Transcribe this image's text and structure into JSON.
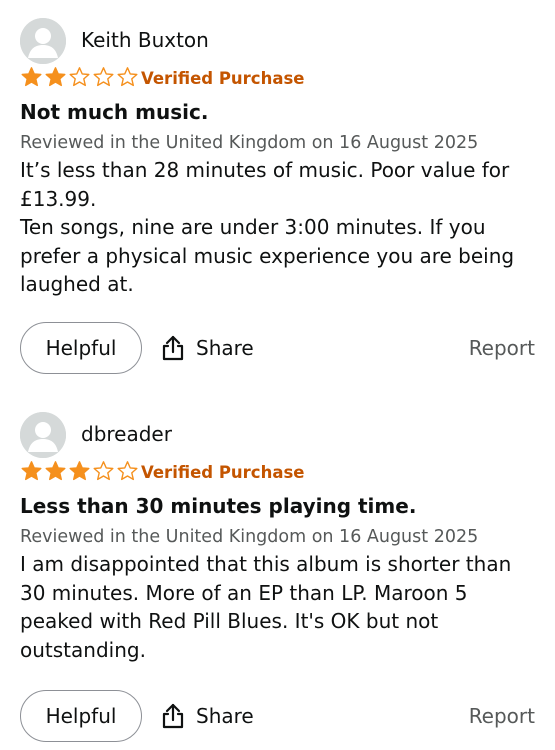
{
  "colors": {
    "star": "#f5901d",
    "verified": "#c45500",
    "meta": "#565959",
    "avatar_bg": "#d5d9d9"
  },
  "reviews": [
    {
      "author": "Keith Buxton",
      "rating": 2,
      "max_rating": 5,
      "badge": "Verified Purchase",
      "title": "Not much music.",
      "meta": "Reviewed in the United Kingdom on 16 August 2025",
      "body_lines": [
        "It’s less than 28 minutes of music. Poor value for",
        "£13.99.",
        "Ten songs, nine are under 3:00 minutes. If you",
        "prefer a physical music experience you are being",
        "laughed at."
      ],
      "helpful_label": "Helpful",
      "share_label": "Share",
      "report_label": "Report"
    },
    {
      "author": "dbreader",
      "rating": 3,
      "max_rating": 5,
      "badge": "Verified Purchase",
      "title": "Less than 30 minutes playing time.",
      "meta": "Reviewed in the United Kingdom on 16 August 2025",
      "body_lines": [
        "I am disappointed that this album is shorter than",
        "30 minutes. More of an EP than LP. Maroon 5",
        "peaked with Red Pill Blues. It's OK but not",
        "outstanding."
      ],
      "helpful_label": "Helpful",
      "share_label": "Share",
      "report_label": "Report"
    }
  ]
}
